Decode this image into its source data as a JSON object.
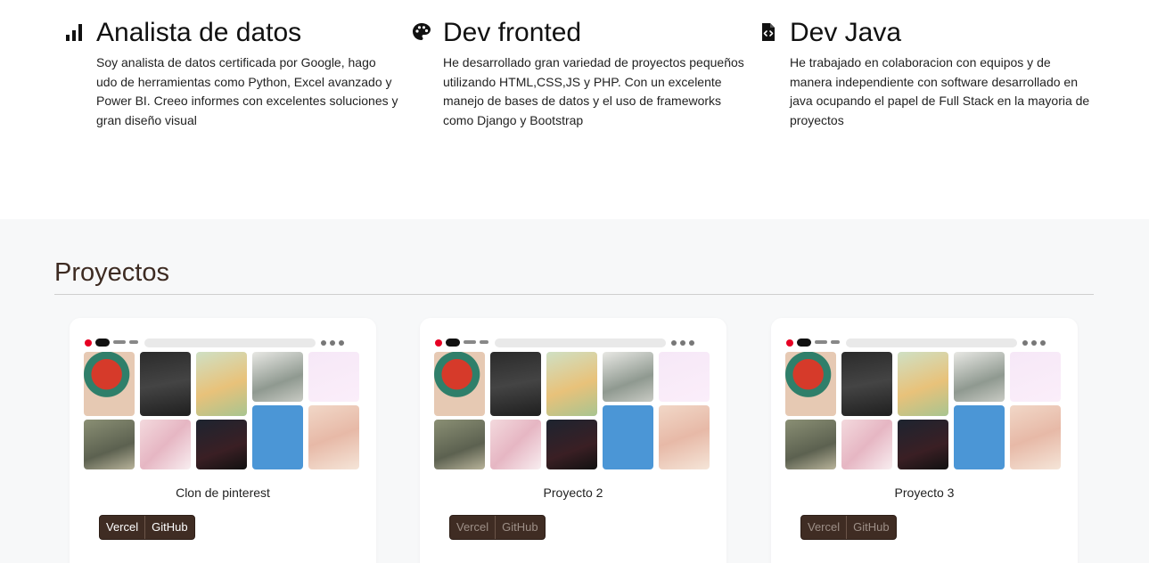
{
  "skills": [
    {
      "icon": "bar-chart-icon",
      "title": "Analista de datos",
      "text": "Soy analista de datos certificada por Google, hago udo de herramientas como Python, Excel avanzado y Power BI. Creeo informes con excelentes soluciones y gran diseño visual"
    },
    {
      "icon": "palette-icon",
      "title": "Dev fronted",
      "text": "He desarrollado gran variedad de proyectos pequeños utilizando HTML,CSS,JS y PHP. Con un excelente manejo de bases de datos y el uso de frameworks como Django y Bootstrap"
    },
    {
      "icon": "code-file-icon",
      "title": "Dev Java",
      "text": "He trabajado en colaboracion con equipos y de manera independiente con software desarrollado en java ocupando el papel de Full Stack en la mayoria de proyectos"
    }
  ],
  "projects": {
    "heading": "Proyectos",
    "cards": [
      {
        "title": "Clon de pinterest",
        "vercel_label": "Vercel",
        "github_label": "GitHub",
        "buttons_enabled": true
      },
      {
        "title": "Proyecto 2",
        "vercel_label": "Vercel",
        "github_label": "GitHub",
        "buttons_enabled": false
      },
      {
        "title": "Proyecto 3",
        "vercel_label": "Vercel",
        "github_label": "GitHub",
        "buttons_enabled": false
      }
    ]
  },
  "colors": {
    "section_bg": "#f7f8f9",
    "heading_brown": "#3d2b22",
    "button_brown": "#3f2c23"
  }
}
